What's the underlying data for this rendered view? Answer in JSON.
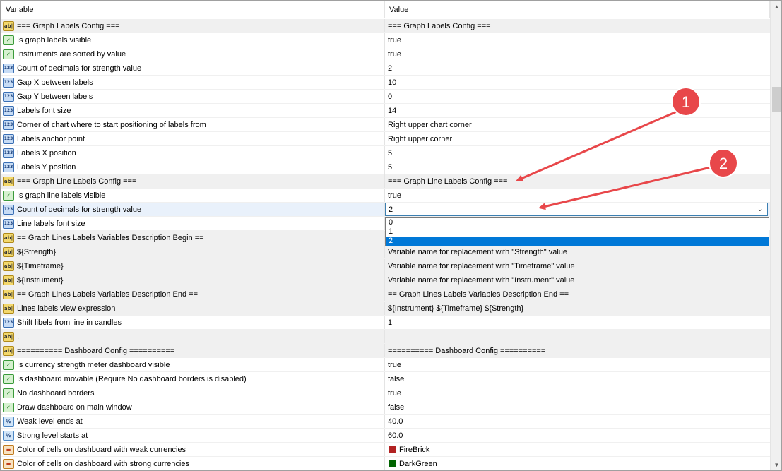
{
  "header": {
    "variable": "Variable",
    "value": "Value"
  },
  "rows": [
    {
      "icon": "ab",
      "name": "=== Graph Labels Config ===",
      "value": "=== Graph Labels Config ==="
    },
    {
      "icon": "bool",
      "name": "Is graph labels visible",
      "value": "true"
    },
    {
      "icon": "bool",
      "name": "Instruments are sorted by value",
      "value": "true"
    },
    {
      "icon": "num",
      "name": "Count of decimals for strength value",
      "value": "2"
    },
    {
      "icon": "num",
      "name": "Gap X between labels",
      "value": "10"
    },
    {
      "icon": "num",
      "name": "Gap Y between labels",
      "value": "0"
    },
    {
      "icon": "num",
      "name": "Labels font size",
      "value": "14"
    },
    {
      "icon": "num",
      "name": "Corner of chart where to start positioning of labels from",
      "value": "Right upper chart corner"
    },
    {
      "icon": "num",
      "name": "Labels anchor point",
      "value": "Right upper corner"
    },
    {
      "icon": "num",
      "name": "Labels X position",
      "value": "5"
    },
    {
      "icon": "num",
      "name": "Labels Y position",
      "value": "5"
    },
    {
      "icon": "ab",
      "name": "=== Graph Line Labels Config ===",
      "value": "=== Graph Line Labels Config ==="
    },
    {
      "icon": "bool",
      "name": "Is graph line labels visible",
      "value": "true"
    },
    {
      "icon": "num",
      "name": "Count of decimals for strength value",
      "value": "2"
    },
    {
      "icon": "num",
      "name": "Line labels font size",
      "value": ""
    },
    {
      "icon": "ab",
      "name": "== Graph Lines Labels Variables Description Begin ==",
      "value": ""
    },
    {
      "icon": "ab",
      "name": "${Strength}",
      "value": "Variable name for replacement with \"Strength\" value"
    },
    {
      "icon": "ab",
      "name": "${Timeframe}",
      "value": "Variable name for replacement with \"Timeframe\" value"
    },
    {
      "icon": "ab",
      "name": "${Instrument}",
      "value": "Variable name for replacement with \"Instrument\" value"
    },
    {
      "icon": "ab",
      "name": "== Graph Lines Labels Variables Description End ==",
      "value": "== Graph Lines Labels Variables Description End =="
    },
    {
      "icon": "ab",
      "name": "Lines labels view expression",
      "value": "${Instrument} ${Timeframe} ${Strength}"
    },
    {
      "icon": "num",
      "name": "Shift libels from line in candles",
      "value": "1"
    },
    {
      "icon": "ab",
      "name": ".",
      "value": ""
    },
    {
      "icon": "ab",
      "name": "========== Dashboard Config ==========",
      "value": "========== Dashboard Config =========="
    },
    {
      "icon": "bool",
      "name": "Is currency strength meter dashboard visible",
      "value": "true"
    },
    {
      "icon": "bool",
      "name": "Is dashboard movable (Require No dashboard borders is disabled)",
      "value": "false"
    },
    {
      "icon": "bool",
      "name": "No dashboard borders",
      "value": "true"
    },
    {
      "icon": "bool",
      "name": "Draw dashboard on main window",
      "value": "false"
    },
    {
      "icon": "frac",
      "name": "Weak level ends at",
      "value": "40.0"
    },
    {
      "icon": "frac",
      "name": "Strong level starts at",
      "value": "60.0"
    },
    {
      "icon": "color",
      "name": "Color of cells on dashboard with weak currencies",
      "value": "FireBrick",
      "swatch": "#b22222"
    },
    {
      "icon": "color",
      "name": "Color of cells on dashboard with strong currencies",
      "value": "DarkGreen",
      "swatch": "#006400"
    }
  ],
  "icon_text": {
    "ab": "ab|",
    "bool": "✓",
    "num": "123",
    "frac": "½",
    "color": "▬"
  },
  "selected_row_index": 13,
  "dropdown": {
    "options": [
      "0",
      "1",
      "2"
    ],
    "selected": "2"
  },
  "annotations": [
    {
      "number": "1",
      "color": "#e8474a"
    },
    {
      "number": "2",
      "color": "#e8474a"
    }
  ]
}
